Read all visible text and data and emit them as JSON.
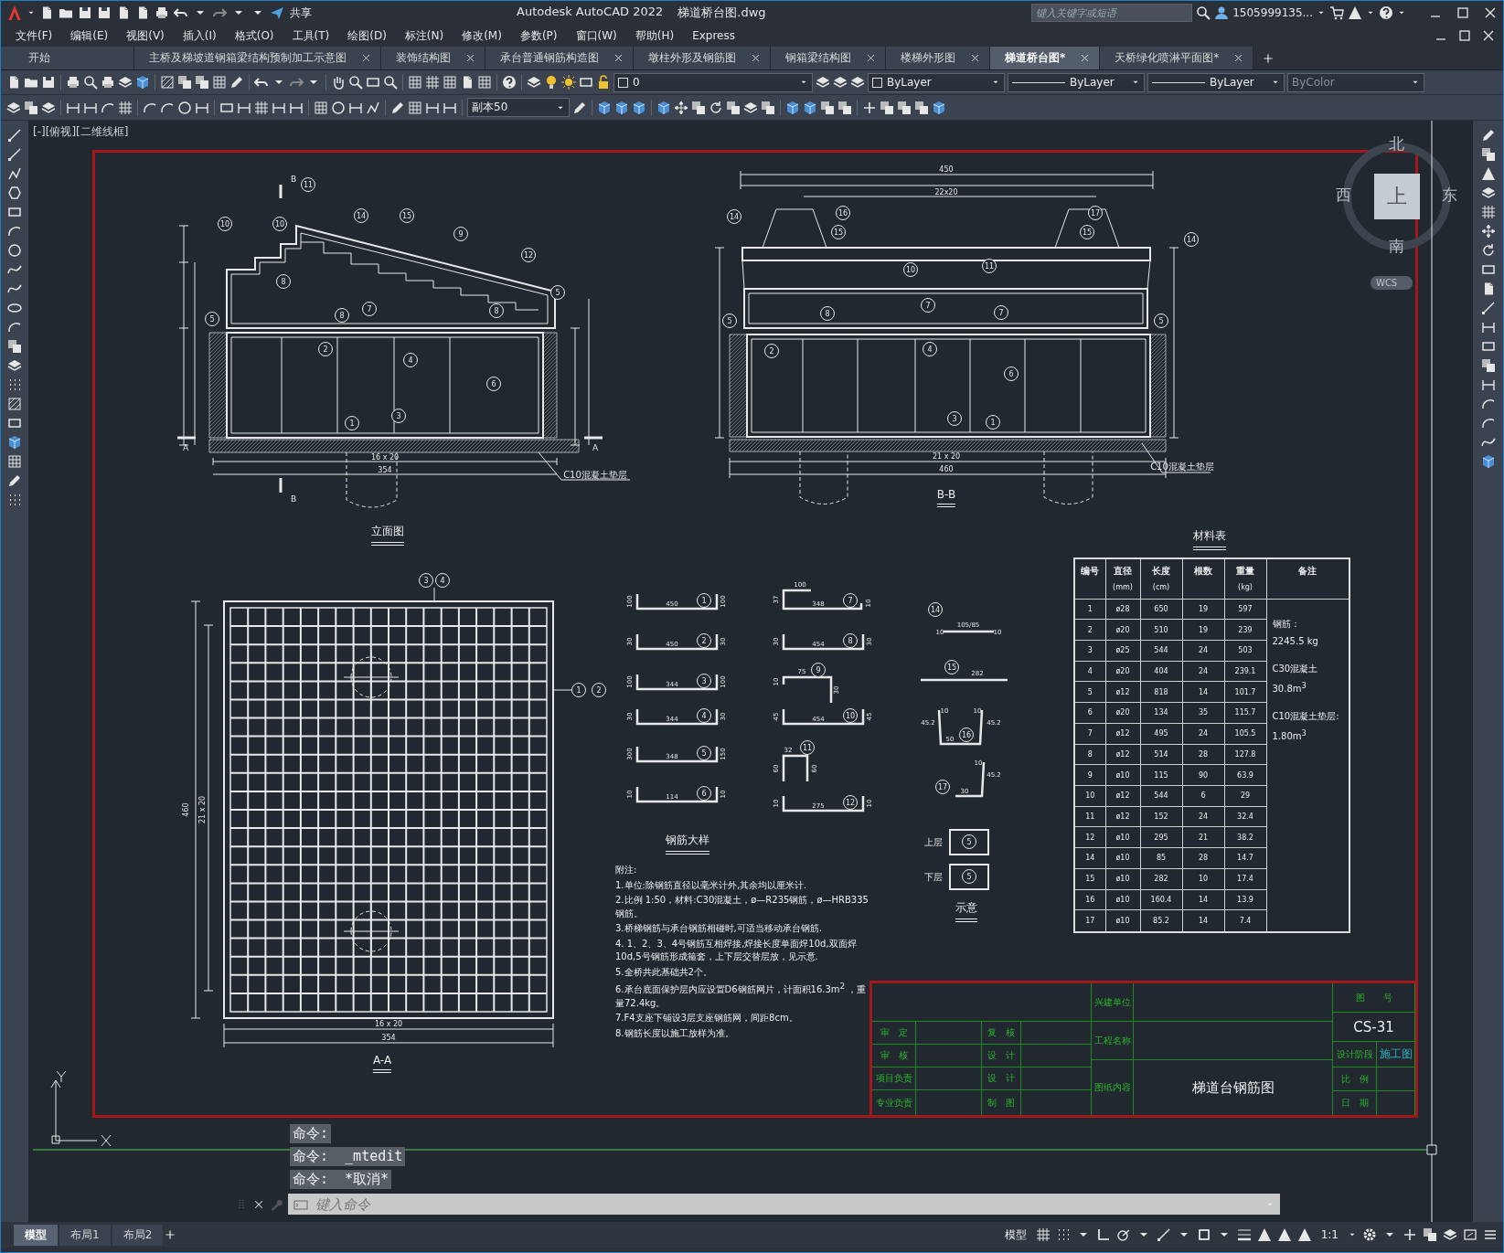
{
  "window": {
    "app_title": "Autodesk AutoCAD 2022",
    "file_title": "梯道桥台图.dwg",
    "share": "共享",
    "search": {
      "placeholder": "键入关键字或短语"
    },
    "user": "1505999135..."
  },
  "menu": [
    "文件(F)",
    "编辑(E)",
    "视图(V)",
    "插入(I)",
    "格式(O)",
    "工具(T)",
    "绘图(D)",
    "标注(N)",
    "修改(M)",
    "参数(P)",
    "窗口(W)",
    "帮助(H)",
    "Express"
  ],
  "file_tabs": [
    {
      "label": "开始",
      "selected": false,
      "closable": false
    },
    {
      "label": "主桥及梯坡道钢箱梁结构预制加工示意图",
      "selected": false,
      "closable": true
    },
    {
      "label": "装饰结构图",
      "selected": false,
      "closable": true
    },
    {
      "label": "承台普通钢筋构造图",
      "selected": false,
      "closable": true
    },
    {
      "label": "墩柱外形及钢筋图",
      "selected": false,
      "closable": true
    },
    {
      "label": "钢箱梁结构图",
      "selected": false,
      "closable": true
    },
    {
      "label": "楼梯外形图",
      "selected": false,
      "closable": true
    },
    {
      "label": "梯道桥台图*",
      "selected": true,
      "closable": true
    },
    {
      "label": "天桥绿化喷淋平面图*",
      "selected": false,
      "closable": true
    }
  ],
  "properties_bar": {
    "layer": "0",
    "swatch": "ByLayer",
    "linetype": "ByLayer",
    "lineweight": "ByLayer",
    "plot_style": {
      "value": "ByColor",
      "disabled": true
    }
  },
  "annotation_scale": "副本50",
  "viewport_label": "[-][俯视][二维线框]",
  "viewcube": {
    "north": "北",
    "west": "西",
    "east": "东",
    "south": "南",
    "face": "上",
    "ucs": "WCS"
  },
  "drawing": {
    "elevation": {
      "title": "立面图",
      "marks": [
        "11",
        "10",
        "10",
        "14",
        "15",
        "9",
        "12",
        "8",
        "5",
        "5",
        "8",
        "7",
        "8",
        "2",
        "4",
        "6",
        "1",
        "3"
      ],
      "section_labels": [
        "B",
        "B",
        "A",
        "A"
      ],
      "dims": [
        "16 x 20",
        "354"
      ],
      "note": "C10混凝土垫层"
    },
    "section_bb": {
      "title": "B-B",
      "marks": [
        "14",
        "16",
        "15",
        "17",
        "15",
        "14",
        "10",
        "11",
        "5",
        "5",
        "8",
        "7",
        "7",
        "2",
        "4",
        "6",
        "3",
        "1"
      ],
      "dims": [
        "450",
        "22x20",
        "21 x 20",
        "460"
      ],
      "note": "C10混凝土垫层"
    },
    "plan_aa": {
      "title": "A-A",
      "marks": [
        "3",
        "4",
        "1",
        "2"
      ],
      "dims": [
        "460",
        "21 x 20",
        "16 x 20",
        "354"
      ]
    },
    "rebar_details": {
      "title": "钢筋大样",
      "items": [
        {
          "mark": "1",
          "kind": "u",
          "dims": [
            "100",
            "450",
            "100"
          ]
        },
        {
          "mark": "2",
          "kind": "u",
          "dims": [
            "30",
            "450",
            "30"
          ]
        },
        {
          "mark": "3",
          "kind": "u",
          "dims": [
            "100",
            "344",
            "100"
          ]
        },
        {
          "mark": "4",
          "kind": "u",
          "dims": [
            "30",
            "344",
            "30"
          ]
        },
        {
          "mark": "5",
          "kind": "u",
          "dims": [
            "300",
            "348",
            "150"
          ]
        },
        {
          "mark": "6",
          "kind": "u",
          "dims": [
            "10",
            "114",
            "10"
          ]
        },
        {
          "mark": "7",
          "kind": "hook",
          "dims": [
            "100",
            "37",
            "348",
            "10"
          ]
        },
        {
          "mark": "8",
          "kind": "u",
          "dims": [
            "30",
            "454",
            "30"
          ]
        },
        {
          "mark": "9",
          "kind": "bent",
          "dims": [
            "75",
            "10",
            "30"
          ]
        },
        {
          "mark": "10",
          "kind": "u",
          "dims": [
            "45",
            "454",
            "45"
          ]
        },
        {
          "mark": "11",
          "kind": "stirrup",
          "dims": [
            "32",
            "60",
            "60"
          ]
        },
        {
          "mark": "12",
          "kind": "u",
          "dims": [
            "10",
            "275",
            "10"
          ]
        },
        {
          "mark": "14",
          "kind": "bar_hooks",
          "dims": [
            "105/85",
            "10",
            "10"
          ]
        },
        {
          "mark": "15",
          "kind": "straight",
          "dims": [
            "282"
          ]
        },
        {
          "mark": "16",
          "kind": "trough",
          "dims": [
            "50",
            "10",
            "10",
            "45.2",
            "45.2"
          ]
        },
        {
          "mark": "17",
          "kind": "angle",
          "dims": [
            "30",
            "10",
            "45.2"
          ]
        }
      ]
    },
    "legend": {
      "title": "示意",
      "items": [
        {
          "label": "上层",
          "mark": "5"
        },
        {
          "label": "下层",
          "mark": "5"
        }
      ]
    },
    "material_table": {
      "title": "材料表",
      "columns": [
        {
          "label": "编号"
        },
        {
          "label": "直径",
          "unit": "(mm)"
        },
        {
          "label": "长度",
          "unit": "(cm)"
        },
        {
          "label": "根数"
        },
        {
          "label": "重量",
          "unit": "(kg)"
        },
        {
          "label": "备注"
        }
      ],
      "rows": [
        [
          "1",
          "ø28",
          "650",
          "19",
          "597"
        ],
        [
          "2",
          "ø20",
          "510",
          "19",
          "239"
        ],
        [
          "3",
          "ø25",
          "544",
          "24",
          "503"
        ],
        [
          "4",
          "ø20",
          "404",
          "24",
          "239.1"
        ],
        [
          "5",
          "ø12",
          "818",
          "14",
          "101.7"
        ],
        [
          "6",
          "ø20",
          "134",
          "35",
          "115.7"
        ],
        [
          "7",
          "ø12",
          "495",
          "24",
          "105.5"
        ],
        [
          "8",
          "ø12",
          "514",
          "28",
          "127.8"
        ],
        [
          "9",
          "ø10",
          "115",
          "90",
          "63.9"
        ],
        [
          "10",
          "ø12",
          "544",
          "6",
          "29"
        ],
        [
          "11",
          "ø12",
          "152",
          "24",
          "32.4"
        ],
        [
          "12",
          "ø10",
          "295",
          "21",
          "38.2"
        ],
        [
          "14",
          "ø10",
          "85",
          "28",
          "14.7"
        ],
        [
          "15",
          "ø10",
          "282",
          "10",
          "17.4"
        ],
        [
          "16",
          "ø10",
          "160.4",
          "14",
          "13.9"
        ],
        [
          "17",
          "ø10",
          "85.2",
          "14",
          "7.4"
        ]
      ],
      "remarks": [
        "钢筋：",
        "2245.5 kg",
        "C30混凝土",
        "30.8m$^{3}$",
        "C10混凝土垫层:",
        "1.80m$^{3}$"
      ]
    },
    "notes": {
      "heading": "附注:",
      "items": [
        "1.单位:除钢筋直径以毫米计外,其余均以厘米计.",
        "2.比例 1:50，材料:C30混凝土，ø—R235钢筋，ø—HRB335钢筋。",
        "3.桥梯钢筋与承台钢筋相碰时,可适当移动承台钢筋.",
        "4. 1、2、3、4号钢筋互相焊接,焊接长度单面焊10d,双面焊10d,5号钢筋形成箍套，上下层交替层放，见示意.",
        "5.全桥共此基础共2个。",
        "6.承台底面保护层内应设置D6钢筋网片，计面积16.3m$^{2}$ ，重量72.4kg。",
        "7.F4支座下铺设3层支座钢筋网，间距8cm。",
        "8.钢筋长度以施工放样为准。"
      ]
    },
    "title_block": {
      "approvals": [
        {
          "role": "审　定",
          "role_2": "复　核"
        },
        {
          "role": "审　核",
          "role_2": "设　计"
        },
        {
          "role": "项目负责",
          "role_2": "设　计"
        },
        {
          "role": "专业负责",
          "role_2": "制　图"
        }
      ],
      "builder_label": "兴建单位",
      "project_label": "工程名称",
      "content_label": "图纸内容",
      "content": "梯道台钢筋图",
      "number_label": "图　　号",
      "number": "CS-31",
      "stage_label": "设计阶段",
      "stage": "施工图",
      "scale_label": "比　例",
      "date_label": "日　期"
    }
  },
  "command": {
    "history": [
      "命令:",
      "命令:  _mtedit",
      "命令:  *取消*"
    ],
    "placeholder": "键入命令"
  },
  "layout_tabs": [
    {
      "label": "模型",
      "selected": true
    },
    {
      "label": "布局1",
      "selected": false
    },
    {
      "label": "布局2",
      "selected": false
    }
  ],
  "status_bar": {
    "model": "模型",
    "scale": "1:1"
  }
}
